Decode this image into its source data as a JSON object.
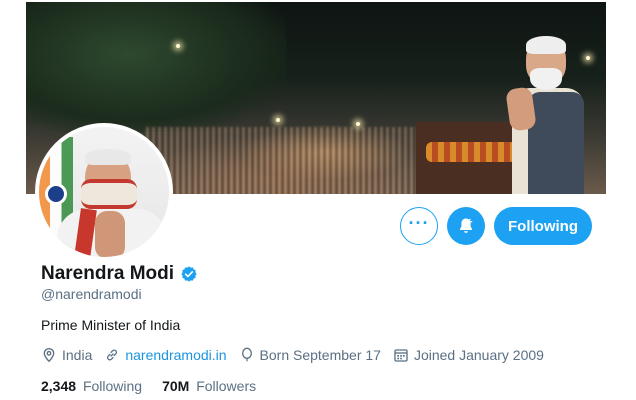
{
  "profile": {
    "name": "Narendra Modi",
    "handle": "@narendramodi",
    "bio": "Prime Minister of India",
    "location": "India",
    "website": "narendramodi.in",
    "birthday": "Born September 17",
    "joined": "Joined January 2009",
    "following_count": "2,348",
    "following_label": "Following",
    "followers_count": "70M",
    "followers_label": "Followers"
  },
  "actions": {
    "more_label": "···",
    "follow_label": "Following"
  },
  "icons": {
    "more": "more-dots-icon",
    "notify": "bell-icon",
    "verified": "verified-badge-icon",
    "location": "location-pin-icon",
    "link": "link-icon",
    "birthday": "balloon-icon",
    "joined": "calendar-icon"
  },
  "colors": {
    "accent": "#1da1f2",
    "link": "#1b95e0",
    "muted": "#5b7083",
    "text": "#14171a"
  }
}
